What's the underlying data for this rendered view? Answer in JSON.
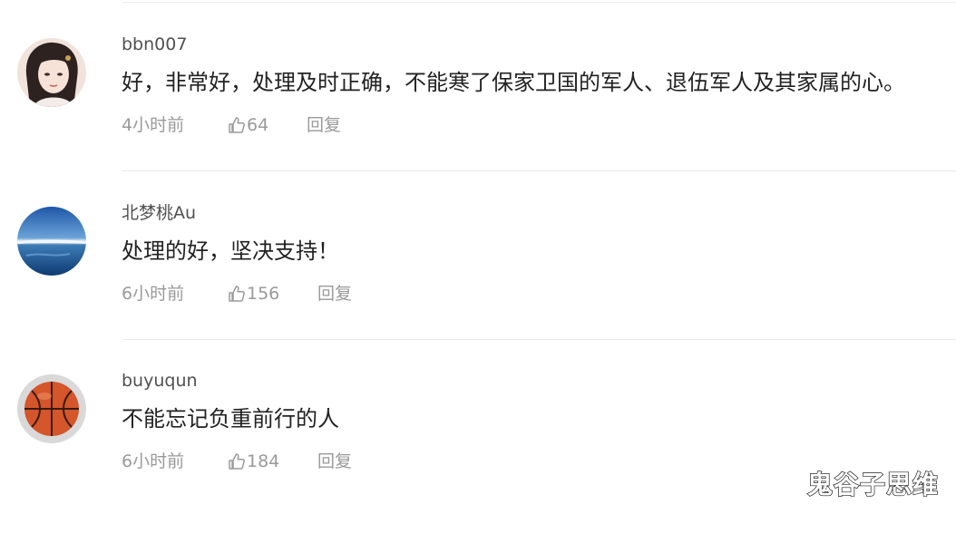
{
  "comments": [
    {
      "username": "bbn007",
      "text": "好，非常好，处理及时正确，不能寒了保家卫国的军人、退伍军人及其家属的心。",
      "time": "4小时前",
      "likes": "64",
      "reply_label": "回复",
      "avatar_icon": "woman-portrait-avatar-icon"
    },
    {
      "username": "北梦桃Au",
      "text": "处理的好，坚决支持！",
      "time": "6小时前",
      "likes": "156",
      "reply_label": "回复",
      "avatar_icon": "ocean-landscape-avatar-icon"
    },
    {
      "username": "buyuqun",
      "text": "不能忘记负重前行的人",
      "time": "6小时前",
      "likes": "184",
      "reply_label": "回复",
      "avatar_icon": "basketball-avatar-icon"
    }
  ],
  "watermark": "鬼谷子思维",
  "colors": {
    "username": "#505050",
    "text": "#222222",
    "meta": "#9a9a9a",
    "divider": "#e8e8e8"
  },
  "icons": {
    "like": "thumbs-up-icon"
  }
}
